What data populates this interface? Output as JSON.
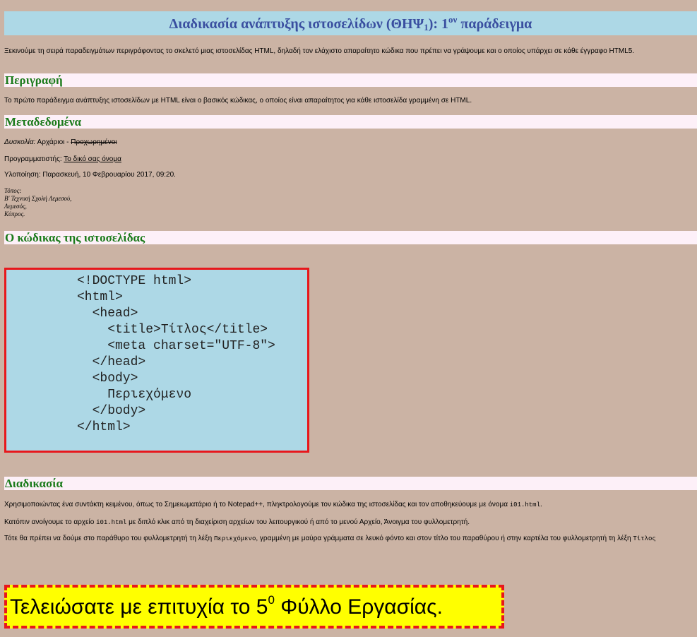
{
  "page_title": {
    "main": "Διαδικασία ανάπτυξης ιστοσελίδων (ΘΗΨ",
    "sub": "1",
    "mid": "): 1",
    "sup": "ον",
    "end": " παράδειγμα"
  },
  "intro": "Ξεκινούμε τη σειρά παραδειγμάτων περιγράφοντας το σκελετό μιας ιστοσελίδας HTML, δηλαδή τον ελάχιστο απαραίτητο κώδικα που πρέπει να γράψουμε και ο οποίος υπάρχει σε κάθε έγγραφο HTML5.",
  "description": {
    "heading": "Περιγραφή",
    "text": "Το πρώτο παράδειγμα ανάπτυξης ιστοσελίδων με HTML είναι ο βασικός κώδικας, ο οποίος είναι απαραίτητος για κάθε ιστοσελίδα γραμμένη σε HTML."
  },
  "metadata": {
    "heading": "Μεταδεδομένα",
    "difficulty_label": "Δυσκολία:",
    "difficulty_value": " Αρχάριοι - ",
    "difficulty_struck": "Προχωρημένοι",
    "programmer_label": "Προγραμματιστής: ",
    "programmer_value": "Το δικό σας όνομα",
    "implementation": "Υλοποίηση: Παρασκευή, 10 Φεβρουαρίου 2017, 09:20.",
    "address": [
      "Τόπος:",
      "Β' Τεχνική Σχολή Λεμεσού,",
      "Λεμεσός,",
      "Κύπρος."
    ]
  },
  "code_section": {
    "heading": "Ο κώδικας της ιστοσελίδας",
    "code": "<!DOCTYPE html>\n<html>\n  <head>\n    <title>Τίτλος</title>\n    <meta charset=\"UTF-8\">\n  </head>\n  <body>\n    Περιεχόμενο\n  </body>\n</html>"
  },
  "procedure": {
    "heading": "Διαδικασία",
    "p1_a": "Χρησιμοποιώντας ένα συντάκτη κειμένου, όπως το Σημειωματάριο ή το Notepad++, πληκτρολογούμε τον κώδικα της ιστοσελίδας και τον αποθηκεύουμε με όνομα ",
    "p1_code": "i01.html",
    "p1_b": ".",
    "p2_a": "Κατόπιν ανοίγουμε το αρχείο ",
    "p2_code": "i01.html",
    "p2_b": " με διπλό κλικ από τη διαχείριση αρχείων του λειτουργικού ή από το μενού Αρχείο, Άνοιγμα του φυλλομετρητή.",
    "p3_a": "Τότε θα πρέπει να δούμε στο παράθυρο του φυλλομετρητή τη λέξη ",
    "p3_code": "Περιεχόμενο",
    "p3_b": ", γραμμένη με μαύρα γράμματα σε λευκό φόντο και στον τίτλο του παραθύρου ή στην καρτέλα του φυλλομετρητή τη λέξη ",
    "p3_code2": "Τίτλος"
  },
  "completion": {
    "before": "Τελειώσατε με επιτυχία το 5",
    "sup": "0",
    "after": " Φύλλο Εργασίας."
  },
  "colors": {
    "background": "#cbb3a4",
    "title_bg": "#add8e6",
    "title_text": "#3a4fa0",
    "heading_bg": "#fdf0f8",
    "heading_text": "#1a7a1a",
    "code_border": "#e8171b",
    "finish_bg": "#ffff00"
  }
}
